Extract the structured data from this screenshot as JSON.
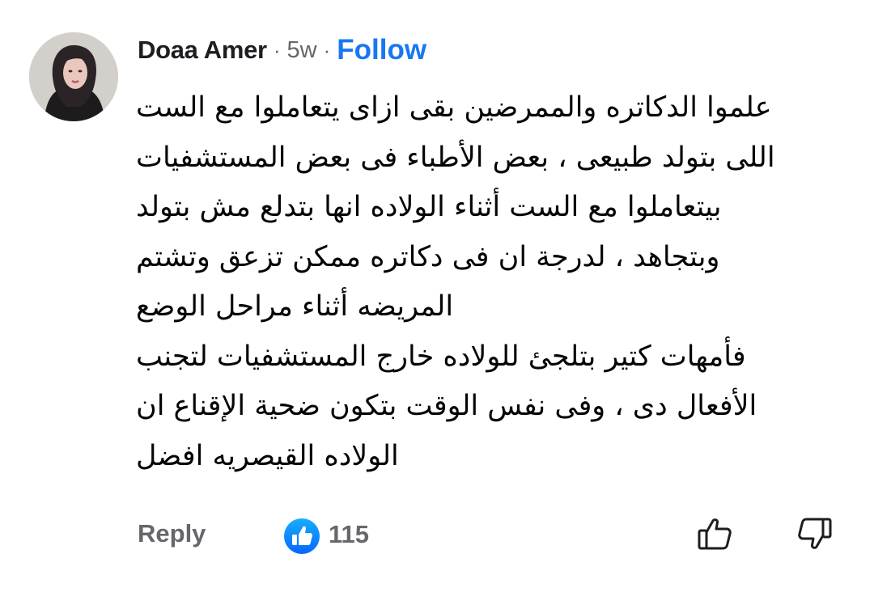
{
  "comment": {
    "author": "Doaa Amer",
    "separator": "·",
    "time": "5w",
    "follow_label": "Follow",
    "lines": [
      "علموا الدكاتره والممرضين بقى ازاى يتعاملوا مع الست",
      "اللى بتولد طبيعى ، بعض الأطباء فى بعض المستشفيات",
      "بيتعاملوا مع الست أثناء الولاده انها بتدلع مش بتولد",
      "وبتجاهد ، لدرجة ان فى دكاتره ممكن تزعق وتشتم",
      " المريضه أثناء مراحل الوضع",
      "فأمهات كتير بتلجئ للولاده خارج المستشفيات لتجنب",
      "الأفعال دى ، وفى نفس الوقت بتكون ضحية الإقناع ان",
      "الولاده القيصريه افضل"
    ]
  },
  "actions": {
    "reply_label": "Reply",
    "like_count": "115",
    "like_icon": "like-badge-icon",
    "upvote_icon": "thumbs-up-outline-icon",
    "downvote_icon": "thumbs-down-outline-icon"
  },
  "colors": {
    "accent": "#1877f2",
    "text": "#050505",
    "muted": "#65676b"
  }
}
